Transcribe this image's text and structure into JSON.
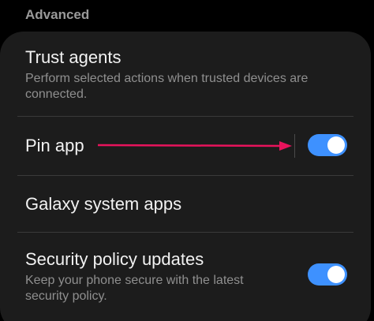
{
  "section": {
    "title": "Advanced"
  },
  "items": [
    {
      "title": "Trust agents",
      "subtitle": "Perform selected actions when trusted devices are connected."
    },
    {
      "title": "Pin app",
      "toggle_on": true
    },
    {
      "title": "Galaxy system apps"
    },
    {
      "title": "Security policy updates",
      "subtitle": "Keep your phone secure with the latest security policy.",
      "toggle_on": true
    }
  ],
  "colors": {
    "accent": "#3e91ff",
    "annotation_arrow": "#e8135c",
    "card_bg": "#1c1c1c",
    "page_bg": "#000000"
  }
}
